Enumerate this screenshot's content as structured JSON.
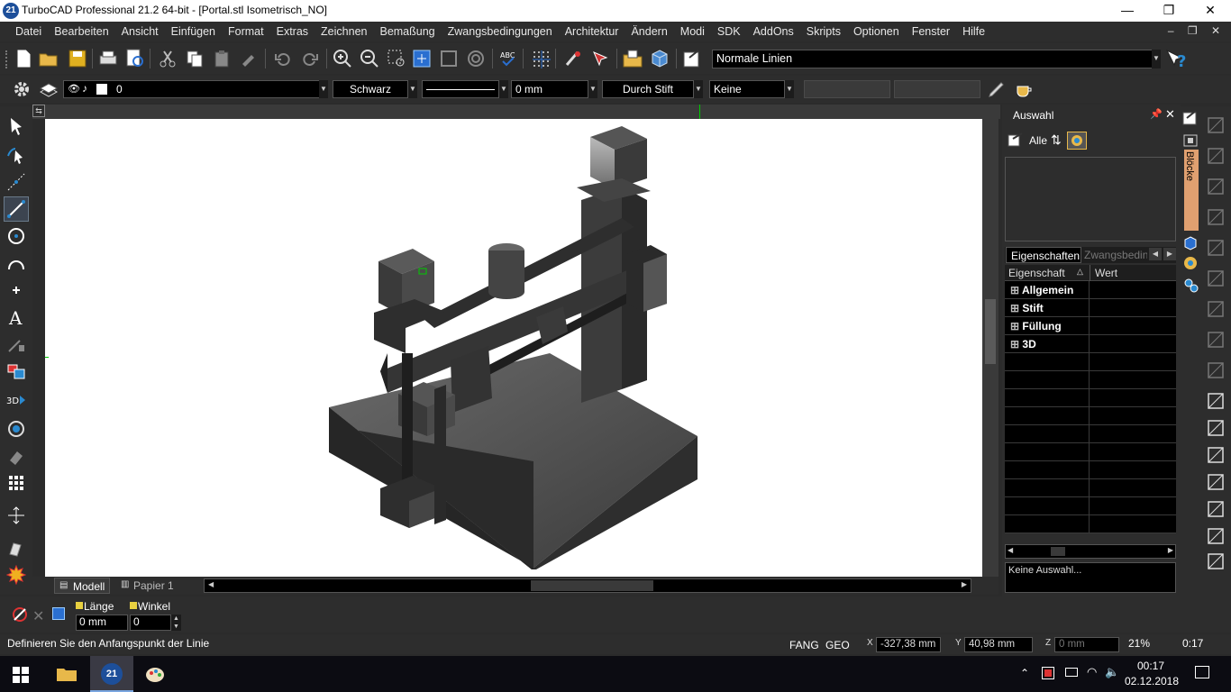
{
  "window": {
    "title": "TurboCAD Professional 21.2 64-bit - [Portal.stl Isometrisch_NO]",
    "app_icon": "tc-app-icon",
    "minimize": "—",
    "maximize": "❐",
    "close": "✕"
  },
  "menu": [
    "Datei",
    "Bearbeiten",
    "Ansicht",
    "Einfügen",
    "Format",
    "Extras",
    "Zeichnen",
    "Bemaßung",
    "Zwangsbedingungen",
    "Architektur",
    "Ändern",
    "Modi",
    "SDK",
    "AddOns",
    "Skripts",
    "Optionen",
    "Fenster",
    "Hilfe"
  ],
  "mdi_controls": "– ❐ ✕",
  "toolbar1": {
    "linestyle_select": "Normale Linien"
  },
  "toolbar2": {
    "layer_value": "0",
    "color_value": "Schwarz",
    "thickness_value": "0 mm",
    "pen_value": "Durch Stift",
    "fill_value": "Keine"
  },
  "tabs": {
    "model": "Modell",
    "paper": "Papier 1"
  },
  "panel": {
    "title": "Auswahl",
    "alle_label": "Alle",
    "bloecke_tab": "Blöcke",
    "tabs": [
      "Eigenschaften",
      "Zwangsbeding"
    ],
    "headers": {
      "property": "Eigenschaft",
      "value": "Wert"
    },
    "groups": [
      "Allgemein",
      "Stift",
      "Füllung",
      "3D"
    ],
    "status": "Keine Auswahl..."
  },
  "inputbar": {
    "length_label": "Länge",
    "length_value": "0 mm",
    "angle_label": "Winkel",
    "angle_value": "0"
  },
  "status": {
    "prompt": "Definieren Sie den Anfangspunkt der Linie",
    "fang": "FANG",
    "geo": "GEO",
    "x_value": "-327,38 mm",
    "y_value": "40,98 mm",
    "z_value": "0 mm",
    "zoom": "21%",
    "time": "0:17"
  },
  "taskbar": {
    "clock_time": "00:17",
    "clock_date": "02.12.2018"
  },
  "colors": {
    "dark_bg": "#2d2d2d",
    "canvas": "#ffffff",
    "accent": "#1d4f9a"
  }
}
